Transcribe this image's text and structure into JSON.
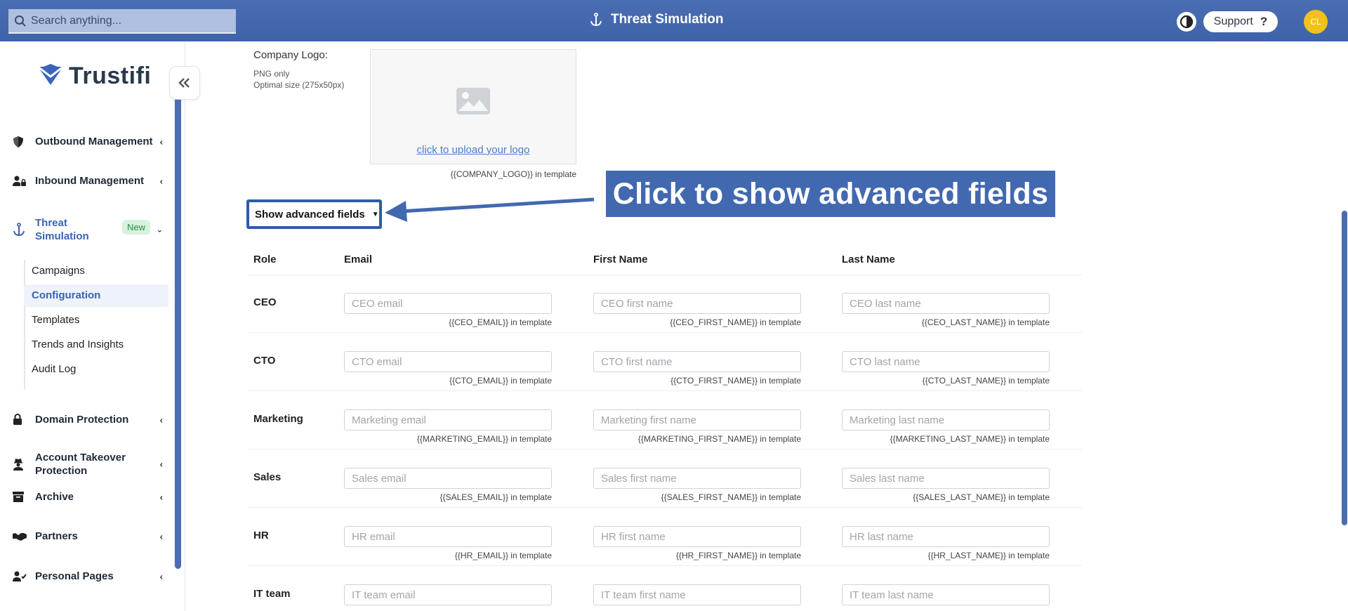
{
  "topbar": {
    "search_placeholder": "Search anything...",
    "title": "Threat Simulation",
    "support_label": "Support",
    "support_q": "?",
    "avatar_initials": "CL"
  },
  "sidebar": {
    "logo_text": "Trustifi",
    "items": [
      {
        "label": "Outbound Management",
        "icon": "shield-icon"
      },
      {
        "label": "Inbound Management",
        "icon": "user-lock-icon"
      },
      {
        "label": "Threat Simulation",
        "icon": "anchor-icon",
        "badge": "New"
      },
      {
        "label": "Domain Protection",
        "icon": "lock-icon"
      },
      {
        "label": "Account Takeover Protection",
        "icon": "user-secret-icon"
      },
      {
        "label": "Archive",
        "icon": "archive-icon"
      },
      {
        "label": "Partners",
        "icon": "handshake-icon"
      },
      {
        "label": "Personal Pages",
        "icon": "user-check-icon"
      }
    ],
    "sub_items": [
      "Campaigns",
      "Configuration",
      "Templates",
      "Trends and Insights",
      "Audit Log"
    ],
    "active_sub": "Configuration"
  },
  "logo_section": {
    "label": "Company Logo:",
    "hint_1": "PNG only",
    "hint_2": "Optimal size (275x50px)",
    "upload_link": "click to upload your logo",
    "template_hint": "{{COMPANY_LOGO}} in template"
  },
  "advanced": {
    "button_label": "Show advanced fields",
    "callout": "Click to show advanced fields"
  },
  "table": {
    "headers": [
      "Role",
      "Email",
      "First Name",
      "Last Name"
    ],
    "rows": [
      {
        "role": "CEO",
        "email_ph": "CEO email",
        "first_ph": "CEO first name",
        "last_ph": "CEO last name",
        "email_t": "{{CEO_EMAIL}} in template",
        "first_t": "{{CEO_FIRST_NAME}} in template",
        "last_t": "{{CEO_LAST_NAME}} in template"
      },
      {
        "role": "CTO",
        "email_ph": "CTO email",
        "first_ph": "CTO first name",
        "last_ph": "CTO last name",
        "email_t": "{{CTO_EMAIL}} in template",
        "first_t": "{{CTO_FIRST_NAME}} in template",
        "last_t": "{{CTO_LAST_NAME}} in template"
      },
      {
        "role": "Marketing",
        "email_ph": "Marketing email",
        "first_ph": "Marketing first name",
        "last_ph": "Marketing last name",
        "email_t": "{{MARKETING_EMAIL}} in template",
        "first_t": "{{MARKETING_FIRST_NAME}} in template",
        "last_t": "{{MARKETING_LAST_NAME}} in template"
      },
      {
        "role": "Sales",
        "email_ph": "Sales email",
        "first_ph": "Sales first name",
        "last_ph": "Sales last name",
        "email_t": "{{SALES_EMAIL}} in template",
        "first_t": "{{SALES_FIRST_NAME}} in template",
        "last_t": "{{SALES_LAST_NAME}} in template"
      },
      {
        "role": "HR",
        "email_ph": "HR email",
        "first_ph": "HR first name",
        "last_ph": "HR last name",
        "email_t": "{{HR_EMAIL}} in template",
        "first_t": "{{HR_FIRST_NAME}} in template",
        "last_t": "{{HR_LAST_NAME}} in template"
      },
      {
        "role": "IT team",
        "email_ph": "IT team email",
        "first_ph": "IT team first name",
        "last_ph": "IT team last name"
      }
    ]
  },
  "colors": {
    "brand": "#4a6db2",
    "callout": "#4268b0",
    "active_text": "#3b63b0",
    "badge_bg": "#d6f3dc",
    "avatar": "#f3c21a"
  }
}
